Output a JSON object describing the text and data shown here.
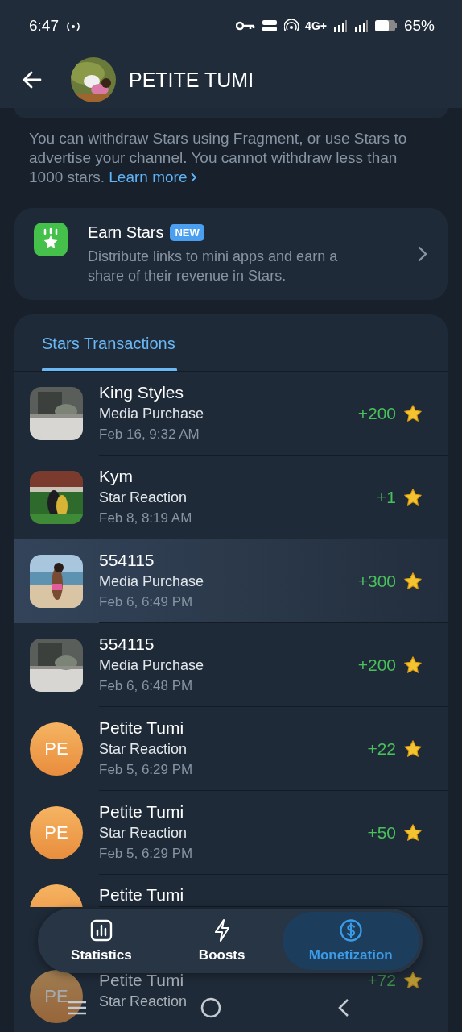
{
  "status_bar": {
    "time": "6:47",
    "network": "4G+",
    "battery": "65%"
  },
  "header": {
    "title": "PETITE TUMI"
  },
  "info": {
    "text": "You can withdraw Stars using Fragment, or use Stars to advertise your channel. You cannot withdraw less than 1000 stars.",
    "link": "Learn more"
  },
  "earn_card": {
    "title": "Earn Stars",
    "badge": "NEW",
    "description": "Distribute links to mini apps and earn a share of their revenue in Stars."
  },
  "transactions": {
    "tabs": [
      {
        "label": "Stars Transactions",
        "selected": true
      }
    ],
    "rows": [
      {
        "kind": "picture",
        "name": "King Styles",
        "type": "Media Purchase",
        "date": "Feb 16, 9:32 AM",
        "amount": "+200",
        "selected": false
      },
      {
        "kind": "picture",
        "name": "Kym",
        "type": "Star Reaction",
        "date": "Feb 8, 8:19 AM",
        "amount": "+1",
        "selected": false
      },
      {
        "kind": "picture",
        "name": "554115",
        "type": "Media Purchase",
        "date": "Feb 6, 6:49 PM",
        "amount": "+300",
        "selected": true
      },
      {
        "kind": "picture",
        "name": "554115",
        "type": "Media Purchase",
        "date": "Feb 6, 6:48 PM",
        "amount": "+200",
        "selected": false
      },
      {
        "kind": "initials",
        "initials": "PE",
        "name": "Petite Tumi",
        "type": "Star Reaction",
        "date": "Feb 5, 6:29 PM",
        "amount": "+22",
        "selected": false
      },
      {
        "kind": "initials",
        "initials": "PE",
        "name": "Petite Tumi",
        "type": "Star Reaction",
        "date": "Feb 5, 6:29 PM",
        "amount": "+50",
        "selected": false
      },
      {
        "kind": "initials",
        "name": "Petite Tumi",
        "selected": false
      },
      {
        "kind": "initials",
        "initials": "PE",
        "name": "Petite Tumi",
        "type": "Star Reaction",
        "amount": "+72",
        "selected": false
      }
    ]
  },
  "bottom_tabs": [
    {
      "label": "Statistics",
      "selected": false
    },
    {
      "label": "Boosts",
      "selected": false
    },
    {
      "label": "Monetization",
      "selected": true
    }
  ]
}
